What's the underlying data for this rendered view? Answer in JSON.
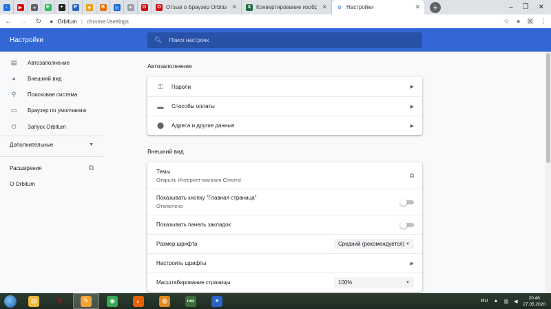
{
  "browser": {
    "pinned_tabs": [
      {
        "icon": "download-icon",
        "color": "#1a73e8",
        "glyph": "↓"
      },
      {
        "icon": "youtube-icon",
        "color": "#e00000",
        "glyph": "▶"
      },
      {
        "icon": "back-arrow-icon",
        "color": "#5f6368",
        "glyph": "◂"
      },
      {
        "icon": "evernote-icon",
        "color": "#2dbe60",
        "glyph": "E"
      },
      {
        "icon": "plus-box-icon",
        "color": "#202124",
        "glyph": "+"
      },
      {
        "icon": "photoshop-icon",
        "color": "#2a64c5",
        "glyph": "P"
      },
      {
        "icon": "orange-circle-icon",
        "color": "#f29900",
        "glyph": "◉"
      },
      {
        "icon": "orange-square-icon",
        "color": "#e8710a",
        "glyph": "B"
      },
      {
        "icon": "blue-square-icon",
        "color": "#1967d2",
        "glyph": "◎"
      },
      {
        "icon": "lightbulb-icon",
        "color": "#9aa0a6",
        "glyph": "✦"
      },
      {
        "icon": "opera-icon",
        "color": "#cc0f16",
        "glyph": "O"
      }
    ],
    "tabs": [
      {
        "title": "Отзыв о Браузер Orbitum | Бе",
        "icon": "opera-icon",
        "color": "#cc0f16",
        "glyph": "O"
      },
      {
        "title": "Конвертирование изображе",
        "icon": "excel-icon",
        "color": "#1e7145",
        "glyph": "X"
      },
      {
        "title": "Настройки",
        "icon": "gear-icon",
        "color": "#1a73e8",
        "glyph": "⚙",
        "active": true
      }
    ],
    "omnibox": {
      "site": "Orbitum",
      "url": "chrome://settings"
    }
  },
  "settings": {
    "header_title": "Настройки",
    "search_placeholder": "Поиск настроек",
    "sidebar": {
      "items": [
        {
          "label": "Автозаполнение",
          "icon": "clipboard-icon"
        },
        {
          "label": "Внешний вид",
          "icon": "palette-icon"
        },
        {
          "label": "Поисковая система",
          "icon": "search-icon"
        },
        {
          "label": "Браузер по умолчанию",
          "icon": "browser-icon"
        },
        {
          "label": "Запуск Orbitum",
          "icon": "power-icon"
        }
      ],
      "advanced": "Дополнительные",
      "extensions": "Расширения",
      "about": "О Orbitum"
    },
    "autofill": {
      "title": "Автозаполнение",
      "rows": [
        {
          "label": "Пароли",
          "icon": "key-icon"
        },
        {
          "label": "Способы оплаты",
          "icon": "credit-card-icon"
        },
        {
          "label": "Адреса и другие данные",
          "icon": "location-pin-icon"
        }
      ]
    },
    "appearance": {
      "title": "Внешний вид",
      "themes_label": "Темы",
      "themes_sub": "Открыть Интернет-магазин Chrome",
      "home_button_label": "Показывать кнопку \"Главная страница\"",
      "home_button_sub": "Отключено",
      "home_button_on": false,
      "bookmarks_bar_label": "Показывать панель закладок",
      "bookmarks_bar_on": false,
      "font_size_label": "Размер шрифта",
      "font_size_value": "Средний (рекомендуется)",
      "customize_fonts_label": "Настроить шрифты",
      "zoom_label": "Масштабирование страницы",
      "zoom_value": "100%"
    }
  },
  "taskbar": {
    "apps": [
      {
        "icon": "explorer-icon",
        "color": "#e8b93c",
        "glyph": "▤"
      },
      {
        "icon": "yandex-browser-icon",
        "color": "#ffffff",
        "glyph": "Y"
      },
      {
        "icon": "paint-icon",
        "color": "#f3a33a",
        "glyph": "✎",
        "active": true
      },
      {
        "icon": "chrome-icon",
        "color": "#34a853",
        "glyph": "◉"
      },
      {
        "icon": "firefox-icon",
        "color": "#e66000",
        "glyph": "◐"
      },
      {
        "icon": "orange-shell-icon",
        "color": "#e08a1e",
        "glyph": "◍"
      },
      {
        "icon": "nox-icon",
        "color": "#3c6e3c",
        "glyph": "nox"
      },
      {
        "icon": "blue-app-icon",
        "color": "#2a64c5",
        "glyph": "✶"
      }
    ],
    "language": "RU",
    "time": "20:46",
    "date": "27.05.2020"
  },
  "colors": {
    "accent": "#3367d6",
    "search_bg": "#2851a8"
  }
}
